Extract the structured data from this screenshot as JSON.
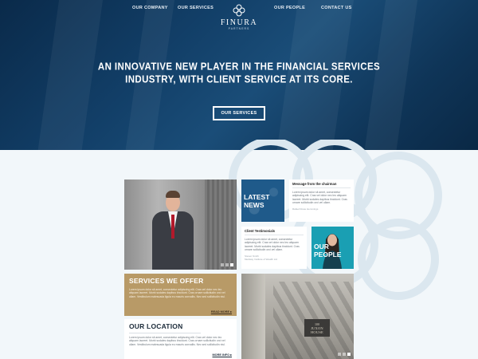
{
  "nav": {
    "items": [
      "OUR COMPANY",
      "OUR SERVICES",
      "OUR PEOPLE",
      "CONTACT US"
    ]
  },
  "brand": {
    "name": "FINURA",
    "tagline": "PARTNERS"
  },
  "hero": {
    "headline_line1": "AN INNOVATIVE NEW PLAYER IN THE FINANCIAL SERVICES",
    "headline_line2": "INDUSTRY, WITH CLIENT SERVICE AT ITS CORE.",
    "button_label": "OUR SERVICES"
  },
  "tiles": {
    "latest_news": {
      "label_line1": "LATEST",
      "label_line2": "NEWS"
    },
    "message": {
      "title": "Message from the chairman",
      "body": "Lorem ipsum dolor sit amet, consectetur adipiscing elit. Cras vel dolor nec leo aliquam laoreet. Morbi sodales dapibus tincidunt. Cras ornare sollicitudin orci vel ullam.",
      "meta": "Rafael Rowe Hemmings"
    },
    "testimonials": {
      "title": "Client Testimonials",
      "body": "Lorem ipsum dolor sit amet, consectetur adipiscing elit. Cras vel dolor nec leo aliquam laoreet. Morbi sodales dapibus tincidunt. Cras ornare sollicitudin orci vel ullam.",
      "meta_line1": "Steven Smith",
      "meta_line2": "Medway Institute of Wealth Ltd"
    },
    "our_people": {
      "label_line1": "OUR",
      "label_line2": "PEOPLE"
    },
    "services": {
      "title": "SERVICES WE OFFER",
      "body": "Lorem ipsum dolor sit amet, consectetur adipiscing elit. Cras vel dolor nec leo aliquam laoreet. Morbi sodales dapibus tincidunt. Cras ornare sollicitudin orci vel ullam. Vestibulum malesuada ligula eu mauris convallis. Nec sed sollicitudin nisl.",
      "readmore": "READ MORE ▸"
    },
    "location": {
      "title": "OUR LOCATION",
      "body": "Lorem ipsum dolor sit amet, consectetur adipiscing elit. Cras vel dolor nec leo aliquam laoreet. Morbi sodales dapibus tincidunt. Cras ornare sollicitudin orci vel ullam. Vestibulum malesuada ligula eu mauris convallis. Nec sed sollicitudin nisl.",
      "readmore": "MORE INFO ▸"
    },
    "juxon": {
      "number": "100",
      "name": "JUXON HOUSE"
    }
  },
  "colors": {
    "hero": "#123f68",
    "services_tan": "#b89a67",
    "people_teal": "#1a9fb3",
    "news_blue": "#1f5a8a"
  }
}
